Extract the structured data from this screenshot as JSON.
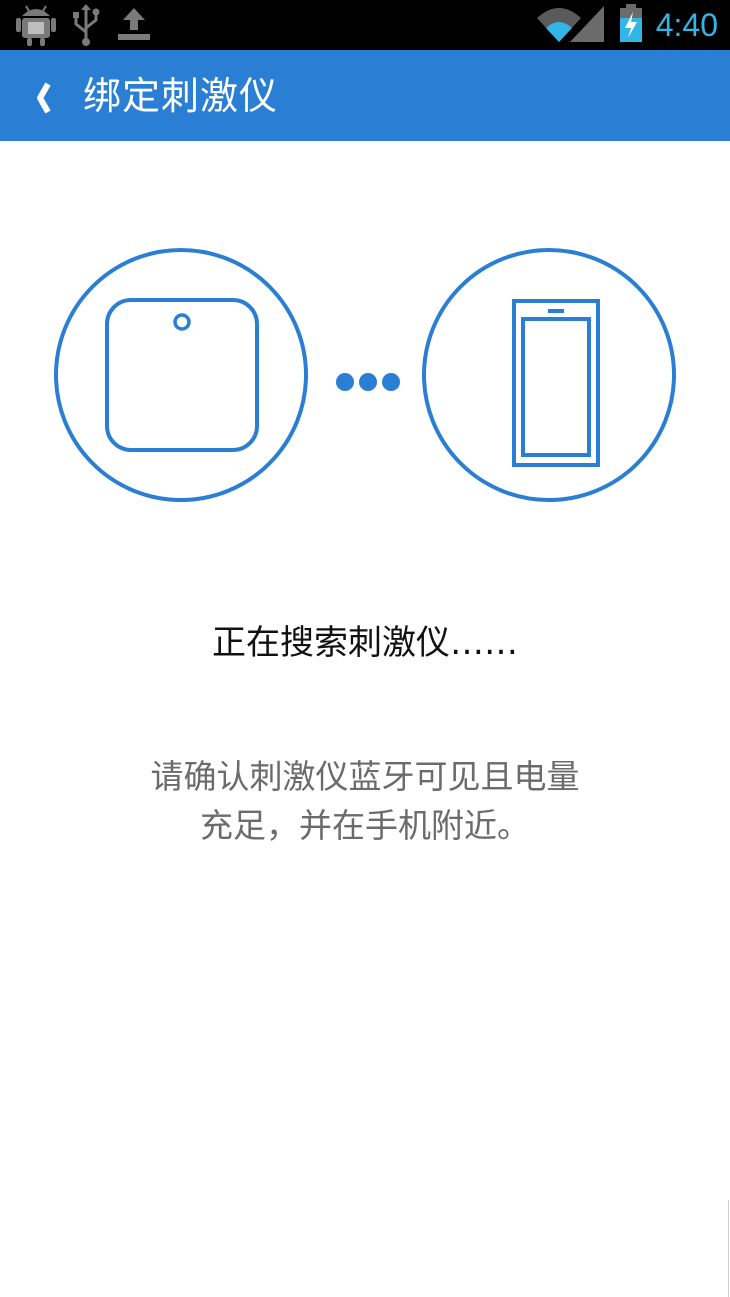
{
  "status_bar": {
    "time": "4:40",
    "time_color": "#33b5e5",
    "icons": [
      "android-debug-icon",
      "usb-icon",
      "upload-icon",
      "wifi-icon",
      "signal-icon",
      "battery-charging-icon"
    ]
  },
  "app_bar": {
    "title": "绑定刺激仪",
    "back_icon": "chevron-left-icon",
    "color": "#2a7fd4"
  },
  "illustration": {
    "left_icon": "stimulator-device-icon",
    "middle_icon": "connecting-dots-icon",
    "right_icon": "phone-icon",
    "accent": "#2a7fd4"
  },
  "main": {
    "status_text": "正在搜索刺激仪……",
    "hint_line1": "请确认刺激仪蓝牙可见且电量",
    "hint_line2": "充足，并在手机附近。"
  }
}
